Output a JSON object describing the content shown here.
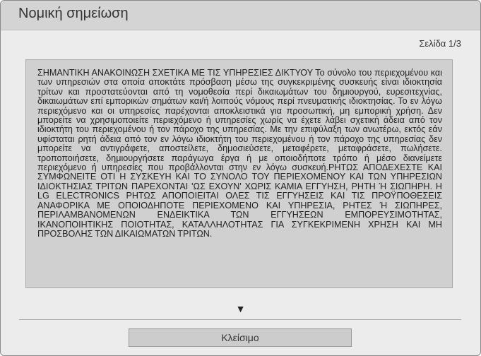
{
  "dialog": {
    "title": "Νομική σημείωση",
    "page_indicator": "Σελίδα 1/3",
    "content": "ΣΗΜΑΝΤΙΚΗ ΑΝΑΚΟΙΝΩΣΗ ΣΧΕΤΙΚΑ ΜΕ ΤΙΣ ΥΠΗΡΕΣΙΕΣ ΔΙΚΤΥΟΥ Το σύνολο του περιεχομένου και των υπηρεσιών στα οποία αποκτάτε πρόσβαση μέσω της συγκεκριμένης συσκευής είναι ιδιοκτησία τρίτων και προστατεύονται από τη νομοθεσία περί δικαιωμάτων του δημιουργού, ευρεσιτεχνίας, δικαιωμάτων επί εμπορικών σημάτων και/ή λοιπούς νόμους περί πνευματικής ιδιοκτησίας. Το εν λόγω περιεχόμενο και οι υπηρεσίες παρέχονται αποκλειστικά για προσωπική, μη εμπορική χρήση. Δεν μπορείτε να χρησιμοποιείτε περιεχόμενο ή υπηρεσίες χωρίς να έχετε λάβει σχετική άδεια από τον ιδιοκτήτη του περιεχομένου ή τον πάροχο της υπηρεσίας. Με την επιφύλαξη των ανωτέρω, εκτός εάν υφίσταται ρητή άδεια από τον εν λόγω ιδιοκτήτη του περιεχομένου ή τον πάροχο της υπηρεσίας δεν μπορείτε να αντιγράφετε, αποστείλετε, δημοσιεύσετε, μεταφέρετε, μεταφράσετε, πωλήσετε. τροποποιήσετε, δημιουργήσετε παράγωγα έργα ή με οποιοδήποτε τρόπο ή μέσο διανείμετε περιεχόμενο ή υπηρεσίες που προβάλλονται στην εν λόγω συσκευή.ΡΗΤΩΣ ΑΠΟΔΕΧΕΣΤΕ ΚΑΙ ΣΥΜΦΩΝΕΙΤΕ ΟΤΙ Η ΣΥΣΚΕΥΗ ΚΑΙ ΤΟ ΣΥΝΟΛΟ ΤΟΥ ΠΕΡΙΕΧΟΜΕΝΟΥ ΚΑΙ ΤΩΝ ΥΠΗΡΕΣΙΩΝ ΙΔΙΟΚΤΗΣΙΑΣ ΤΡΙΤΩΝ ΠΑΡΕΧΟΝΤΑΙ 'ΩΣ ΕΧΟΥΝ' ΧΩΡΙΣ ΚΑΜΙΑ ΕΓΓΥΗΣΗ, ΡΗΤΗ Ή ΣΙΩΠΗΡΗ. Η LG ELECTRONICS ΡΗΤΩΣ ΑΠΟΠΟΙΕΙΤΑΙ ΟΛΕΣ ΤΙΣ ΕΓΓΥΗΣΕΙΣ ΚΑΙ ΤΙΣ ΠΡΟΫΠΟΘΕΣΕΙΣ ΑΝΑΦΟΡΙΚΑ ΜΕ ΟΠΟΙΟΔΗΠΟΤΕ ΠΕΡΙΕΧΟΜΕΝΟ ΚΑΙ ΥΠΗΡΕΣΙΑ, ΡΗΤΕΣ Ή ΣΙΩΠΗΡΕΣ, ΠΕΡΙΛΑΜΒΑΝΟΜΕΝΩΝ ΕΝΔΕΙΚΤΙΚΑ ΤΩΝ ΕΓΓΥΗΣΕΩΝ ΕΜΠΟΡΕΥΣΙΜΟΤΗΤΑΣ, ΙΚΑΝΟΠΟΙΗΤΙΚΗΣ ΠΟΙΟΤΗΤΑΣ, ΚΑΤΑΛΛΗΛΟΤΗΤΑΣ ΓΙΑ ΣΥΓΚΕΚΡΙΜΕΝΗ ΧΡΗΣΗ ΚΑΙ ΜΗ ΠΡΟΣΒΟΛΗΣ ΤΩΝ ΔΙΚΑΙΩΜΑΤΩΝ ΤΡΙΤΩΝ.",
    "scroll_indicator": "▼",
    "close_label": "Κλείσιμο"
  }
}
